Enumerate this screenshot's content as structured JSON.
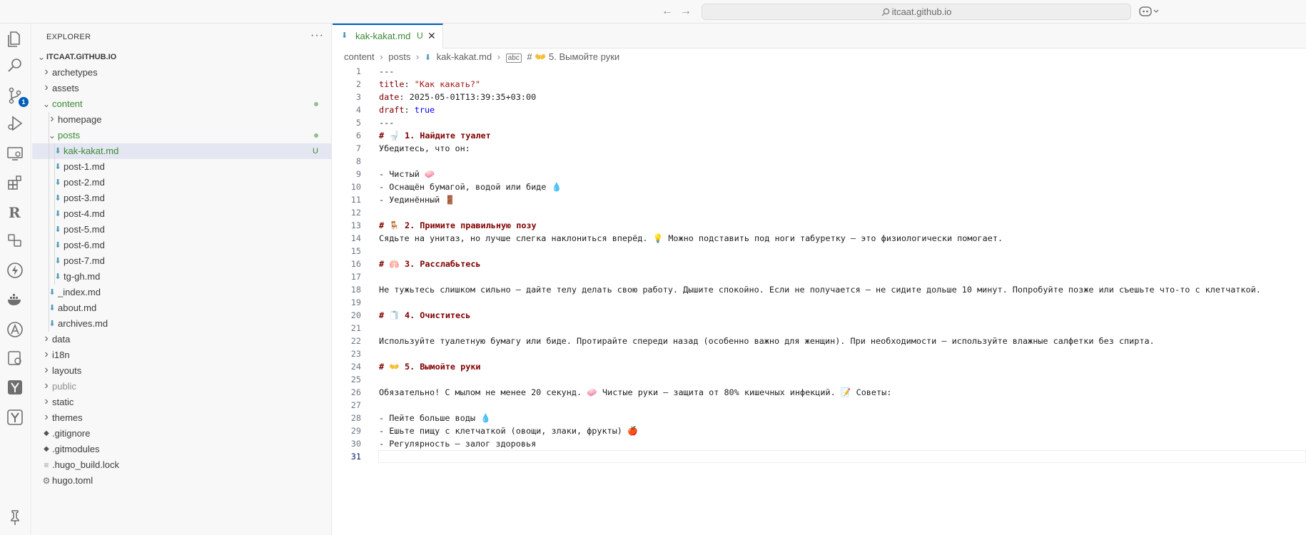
{
  "titlebar": {
    "search_text": "itcaat.github.io"
  },
  "activitybar": {
    "items": [
      {
        "name": "explorer-icon"
      },
      {
        "name": "search-icon"
      },
      {
        "name": "source-control-icon",
        "badge": "1"
      },
      {
        "name": "run-debug-icon"
      },
      {
        "name": "remote-explorer-icon"
      },
      {
        "name": "extensions-icon"
      },
      {
        "name": "extension-r-icon"
      },
      {
        "name": "extension-boxes-icon"
      },
      {
        "name": "extension-bolt-icon"
      },
      {
        "name": "docker-icon"
      },
      {
        "name": "extension-a-icon"
      },
      {
        "name": "extension-gear-box-icon"
      },
      {
        "name": "extension-y-icon"
      },
      {
        "name": "extension-y2-icon"
      },
      {
        "name": "pin-icon"
      }
    ]
  },
  "sidebar": {
    "title": "EXPLORER",
    "more": "···",
    "root": "ITCAAT.GITHUB.IO",
    "items": [
      {
        "label": "archetypes",
        "type": "folder",
        "depth": 1,
        "open": false
      },
      {
        "label": "assets",
        "type": "folder",
        "depth": 1,
        "open": false
      },
      {
        "label": "content",
        "type": "folder",
        "depth": 1,
        "open": true,
        "color": "green",
        "dot": true
      },
      {
        "label": "homepage",
        "type": "folder",
        "depth": 2,
        "open": false
      },
      {
        "label": "posts",
        "type": "folder",
        "depth": 2,
        "open": true,
        "color": "green",
        "dot": true
      },
      {
        "label": "kak-kakat.md",
        "type": "md",
        "depth": 3,
        "color": "green",
        "status": "U",
        "selected": true
      },
      {
        "label": "post-1.md",
        "type": "md",
        "depth": 3
      },
      {
        "label": "post-2.md",
        "type": "md",
        "depth": 3
      },
      {
        "label": "post-3.md",
        "type": "md",
        "depth": 3
      },
      {
        "label": "post-4.md",
        "type": "md",
        "depth": 3
      },
      {
        "label": "post-5.md",
        "type": "md",
        "depth": 3
      },
      {
        "label": "post-6.md",
        "type": "md",
        "depth": 3
      },
      {
        "label": "post-7.md",
        "type": "md",
        "depth": 3
      },
      {
        "label": "tg-gh.md",
        "type": "md",
        "depth": 3
      },
      {
        "label": "_index.md",
        "type": "md",
        "depth": 2
      },
      {
        "label": "about.md",
        "type": "md",
        "depth": 2
      },
      {
        "label": "archives.md",
        "type": "md",
        "depth": 2
      },
      {
        "label": "data",
        "type": "folder",
        "depth": 1,
        "open": false
      },
      {
        "label": "i18n",
        "type": "folder",
        "depth": 1,
        "open": false
      },
      {
        "label": "layouts",
        "type": "folder",
        "depth": 1,
        "open": false
      },
      {
        "label": "public",
        "type": "folder",
        "depth": 1,
        "open": false,
        "color": "grey"
      },
      {
        "label": "static",
        "type": "folder",
        "depth": 1,
        "open": false
      },
      {
        "label": "themes",
        "type": "folder",
        "depth": 1,
        "open": false
      },
      {
        "label": ".gitignore",
        "type": "git",
        "depth": 1
      },
      {
        "label": ".gitmodules",
        "type": "git",
        "depth": 1
      },
      {
        "label": ".hugo_build.lock",
        "type": "lock",
        "depth": 1
      },
      {
        "label": "hugo.toml",
        "type": "gear",
        "depth": 1
      }
    ]
  },
  "editor": {
    "tab": {
      "label": "kak-kakat.md",
      "status": "U",
      "close": "✕"
    },
    "breadcrumb": {
      "parts": [
        "content",
        "posts",
        "kak-kakat.md"
      ],
      "symbol": "# 👐 5. Вымойте руки",
      "sep": "›"
    },
    "current_line": 31,
    "lines": [
      {
        "n": "1",
        "text": "---"
      },
      {
        "n": "2",
        "key": "title",
        "value": "\"Как какать?\"",
        "vtype": "str"
      },
      {
        "n": "3",
        "key": "date",
        "value": "2025-05-01T13:39:35+03:00",
        "vtype": "plain"
      },
      {
        "n": "4",
        "key": "draft",
        "value": "true",
        "vtype": "kw"
      },
      {
        "n": "5",
        "text": "---"
      },
      {
        "n": "6",
        "head": "# 🚽 1. Найдите туалет"
      },
      {
        "n": "7",
        "text": "Убедитесь, что он:"
      },
      {
        "n": "8",
        "text": ""
      },
      {
        "n": "9",
        "text": "- Чистый 🧼"
      },
      {
        "n": "10",
        "text": "- Оснащён бумагой, водой или биде 💧"
      },
      {
        "n": "11",
        "text": "- Уединённый 🚪"
      },
      {
        "n": "12",
        "text": ""
      },
      {
        "n": "13",
        "head": "# 🪑 2. Примите правильную позу"
      },
      {
        "n": "14",
        "text": "Сядьте на унитаз, но лучше слегка наклониться вперёд. 💡 Можно подставить под ноги табуретку — это физиологически помогает."
      },
      {
        "n": "15",
        "text": ""
      },
      {
        "n": "16",
        "head": "# 🫁 3. Расслабьтесь"
      },
      {
        "n": "17",
        "text": ""
      },
      {
        "n": "18",
        "text": "Не тужьтесь слишком сильно — дайте телу делать свою работу. Дышите спокойно. Если не получается — не сидите дольше 10 минут. Попробуйте позже или съешьте что-то с клетчаткой."
      },
      {
        "n": "19",
        "text": ""
      },
      {
        "n": "20",
        "head": "# 🧻 4. Очиститесь"
      },
      {
        "n": "21",
        "text": ""
      },
      {
        "n": "22",
        "text": "Используйте туалетную бумагу или биде. Протирайте спереди назад (особенно важно для женщин). При необходимости — используйте влажные салфетки без спирта."
      },
      {
        "n": "23",
        "text": ""
      },
      {
        "n": "24",
        "head": "# 👐 5. Вымойте руки"
      },
      {
        "n": "25",
        "text": ""
      },
      {
        "n": "26",
        "text": "Обязательно! С мылом не менее 20 секунд. 🧼 Чистые руки — защита от 80% кишечных инфекций. 📝 Советы:"
      },
      {
        "n": "27",
        "text": ""
      },
      {
        "n": "28",
        "text": "- Пейте больше воды 💧"
      },
      {
        "n": "29",
        "text": "- Ешьте пищу с клетчаткой (овощи, злаки, фрукты) 🍎"
      },
      {
        "n": "30",
        "text": "- Регулярность — залог здоровья"
      },
      {
        "n": "31",
        "text": ""
      }
    ]
  }
}
